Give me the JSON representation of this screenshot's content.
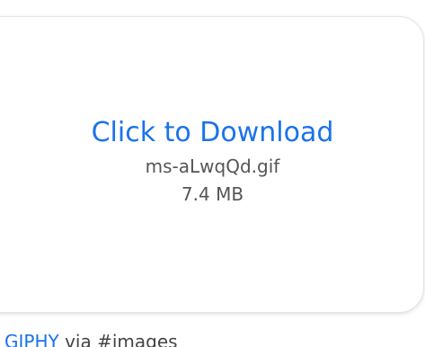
{
  "download": {
    "link_label": "Click to Download",
    "file_name": "ms-aLwqQd.gif",
    "file_size": "7.4 MB"
  },
  "footer": {
    "source_label": "GIPHY",
    "via_text": "via #images"
  },
  "colors": {
    "link": "#1a73e8",
    "secondary_text": "#555555",
    "card_border": "#e6e6e6"
  }
}
